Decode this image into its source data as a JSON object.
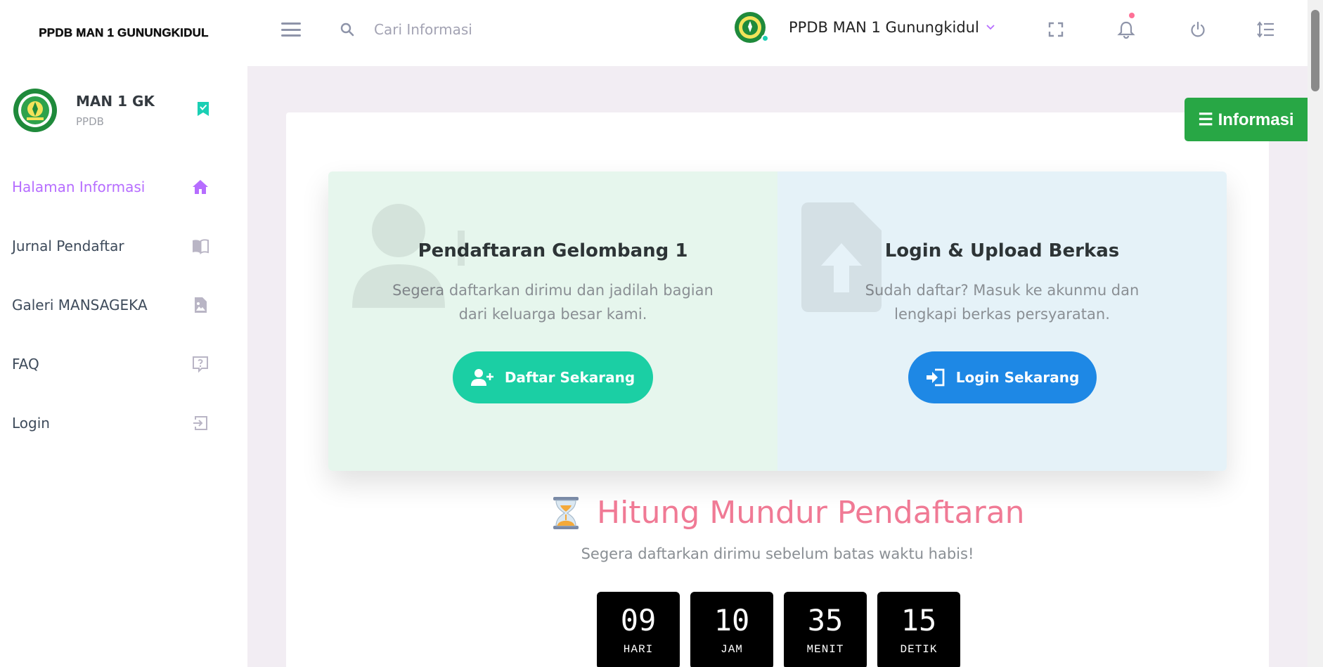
{
  "brand": {
    "title": "PPDB MAN 1 GUNUNGKIDUL"
  },
  "search": {
    "placeholder": "Cari Informasi"
  },
  "navbar": {
    "profile_name": "PPDB MAN 1 Gunungkidul",
    "icons": [
      "fullscreen-icon",
      "bell-icon",
      "power-icon",
      "format-line-spacing-icon"
    ]
  },
  "sidebar": {
    "profile": {
      "name": "MAN 1 GK",
      "role": "PPDB"
    },
    "items": [
      {
        "label": "Halaman Informasi",
        "icon": "home-icon",
        "active": true
      },
      {
        "label": "Jurnal Pendaftar",
        "icon": "book-open-icon",
        "active": false
      },
      {
        "label": "Galeri MANSAGEKA",
        "icon": "image-icon",
        "active": false
      },
      {
        "label": "FAQ",
        "icon": "help-box-icon",
        "active": false
      },
      {
        "label": "Login",
        "icon": "login-icon",
        "active": false
      }
    ]
  },
  "info_button": {
    "label": "☰ Informasi"
  },
  "register_panel": {
    "title": "Pendaftaran Gelombang 1",
    "description": "Segera daftarkan dirimu dan jadilah bagian dari keluarga besar kami.",
    "button_label": "Daftar Sekarang"
  },
  "login_panel": {
    "title": "Login & Upload Berkas",
    "description": "Sudah daftar? Masuk ke akunmu dan lengkapi berkas persyaratan.",
    "button_label": "Login Sekarang"
  },
  "countdown": {
    "title": "Hitung Mundur Pendaftaran",
    "subtitle": "Segera daftarkan dirimu sebelum batas waktu habis!",
    "units": [
      {
        "value": "09",
        "label": "HARI"
      },
      {
        "value": "10",
        "label": "JAM"
      },
      {
        "value": "35",
        "label": "MENIT"
      },
      {
        "value": "15",
        "label": "DETIK"
      }
    ]
  },
  "colors": {
    "accent_purple": "#b66dff",
    "teal": "#1bcfa4",
    "blue": "#1e88e5",
    "green": "#28a745",
    "countdown_pink": "#f07a95"
  }
}
